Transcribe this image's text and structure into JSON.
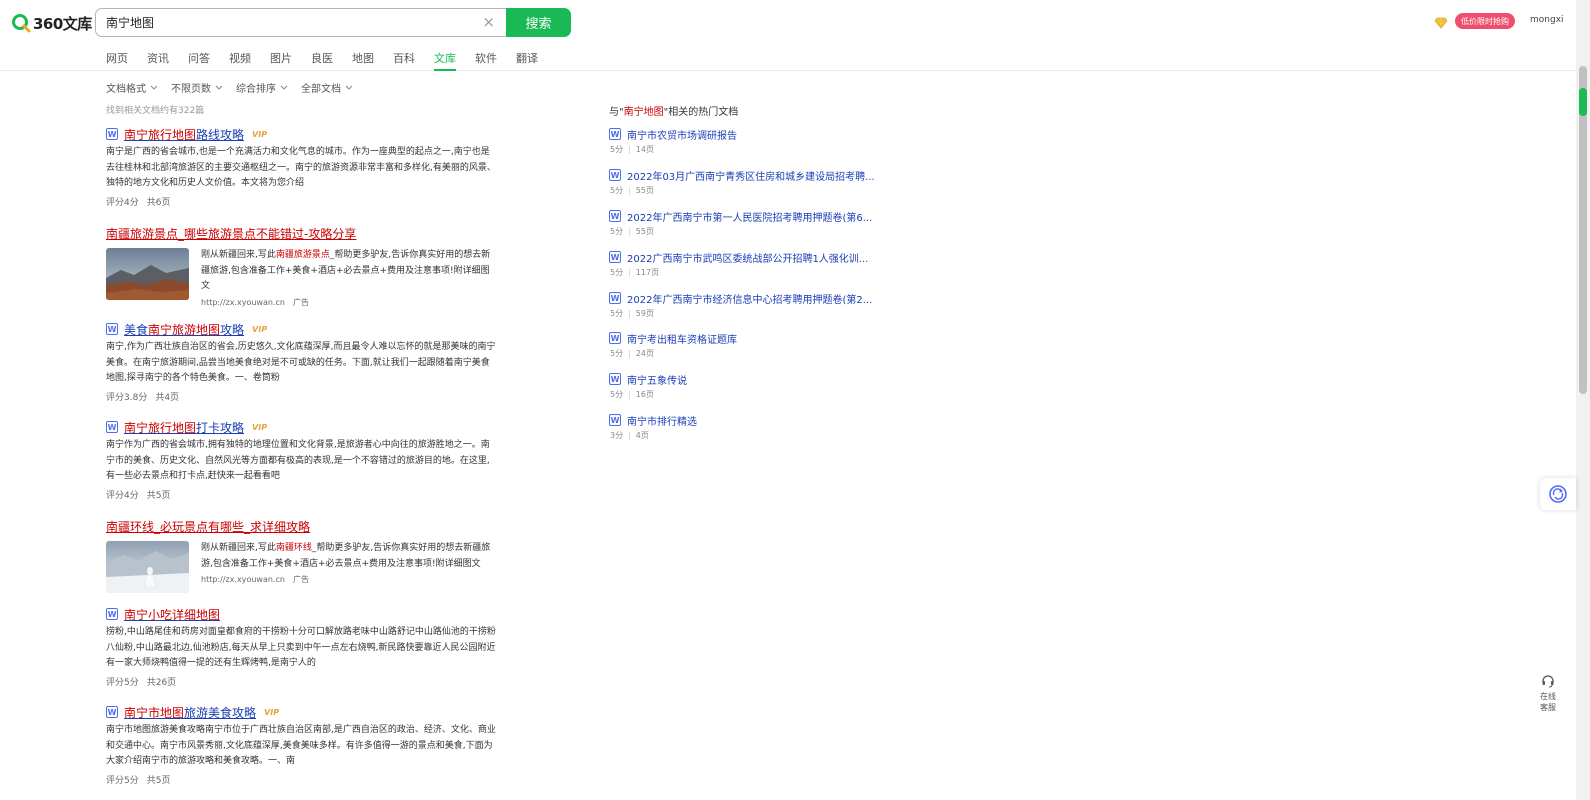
{
  "header": {
    "logo_text": "360文库",
    "search_value": "南宁地图",
    "search_button": "搜索",
    "clear_symbol": "×",
    "promo_label": "低价限时抢购",
    "username": "mongxi"
  },
  "nav": [
    "网页",
    "资讯",
    "问答",
    "视频",
    "图片",
    "良医",
    "地图",
    "百科",
    "文库",
    "软件",
    "翻译"
  ],
  "filters": [
    "文档格式",
    "不限页数",
    "综合排序",
    "全部文档"
  ],
  "result_count": "找到相关文档约有322篇",
  "results": [
    {
      "title_pre": "",
      "title_hl": "南宁旅行地图",
      "title_post": "路线攻略",
      "vip": "VIP",
      "snippet": "南宁是广西的省会城市,也是一个充满活力和文化气息的城市。作为一座典型的起点之一,南宁也是去往桂林和北部湾旅游区的主要交通枢纽之一。南宁的旅游资源非常丰富和多样化,有美丽的风景、独特的地方文化和历史人文价值。本文将为您介绍",
      "rating": "评分4分",
      "pages": "共6页"
    },
    {
      "title_pre": "美食",
      "title_hl": "南宁旅游地图",
      "title_post": "攻略",
      "vip": "VIP",
      "snippet": "南宁,作为广西壮族自治区的省会,历史悠久,文化底蕴深厚,而且最令人难以忘怀的就是那美味的南宁美食。在南宁旅游期间,品尝当地美食绝对是不可或缺的任务。下面,就让我们一起跟随着南宁美食地图,探寻南宁的各个特色美食。一、卷筒粉",
      "rating": "评分3.8分",
      "pages": "共4页"
    },
    {
      "title_pre": "",
      "title_hl": "南宁旅行地图",
      "title_post": "打卡攻略",
      "vip": "VIP",
      "snippet": "南宁作为广西的省会城市,拥有独特的地理位置和文化背景,是旅游者心中向往的旅游胜地之一。南宁市的美食、历史文化、自然风光等方面都有极高的表现,是一个不容错过的旅游目的地。在这里,有一些必去景点和打卡点,赶快来一起看看吧",
      "rating": "评分4分",
      "pages": "共5页"
    },
    {
      "title_pre": "",
      "title_hl": "南宁小吃详细地图",
      "title_post": "",
      "vip": "",
      "snippet": "捞粉,中山路尾佳和药房对面皇都食府的干捞粉十分可口解放路老味中山路舒记中山路仙池的干捞粉八仙粉,中山路最北边,仙池粉店,每天从早上只卖到中午一点左右烧鸭,新民路快要靠近人民公园附近有一家大师烧鸭值得一提的还有生辉烤鸭,是南宁人的",
      "rating": "评分5分",
      "pages": "共26页"
    },
    {
      "title_pre": "",
      "title_hl": "南宁市地图",
      "title_post": "旅游美食攻略",
      "vip": "VIP",
      "snippet": "南宁市地图旅游美食攻略南宁市位于广西壮族自治区南部,是广西自治区的政治、经济、文化、商业和交通中心。南宁市风景秀丽,文化底蕴深厚,美食美味多样。有许多值得一游的景点和美食,下面为大家介绍南宁市的旅游攻略和美食攻略。一、南",
      "rating": "评分5分",
      "pages": "共5页"
    }
  ],
  "ads": [
    {
      "title": "南疆旅游景点_哪些旅游景点不能错过-攻略分享",
      "snippet_pre": "刚从新疆回来,写此",
      "snippet_hl": "南疆旅游景点",
      "snippet_post": "_帮助更多驴友,告诉你真实好用的想去新疆旅游,包含准备工作+美食+酒店+必去景点+费用及注意事项!附详细图文",
      "url": "http://zx.xyouwan.cn",
      "ad_label": "广告"
    },
    {
      "title": "南疆环线_必玩景点有哪些_求详细攻略",
      "snippet_pre": "刚从新疆回来,写此",
      "snippet_hl": "南疆环线",
      "snippet_post": "_帮助更多驴友,告诉你真实好用的想去新疆旅游,包含准备工作+美食+酒店+必去景点+费用及注意事项!附详细图文",
      "url": "http://zx.xyouwan.cn",
      "ad_label": "广告"
    }
  ],
  "related": {
    "title_pre": "与\"",
    "title_hl": "南宁地图",
    "title_post": "\"相关的热门文档",
    "items": [
      {
        "title": "南宁市农贸市场调研报告",
        "score": "5分",
        "pages": "14页"
      },
      {
        "title": "2022年03月广西南宁青秀区住房和城乡建设局招考聘...",
        "score": "5分",
        "pages": "55页"
      },
      {
        "title": "2022年广西南宁市第一人民医院招考聘用押题卷(第6...",
        "score": "5分",
        "pages": "55页"
      },
      {
        "title": "2022广西南宁市武鸣区委统战部公开招聘1人强化训...",
        "score": "5分",
        "pages": "117页"
      },
      {
        "title": "2022年广西南宁市经济信息中心招考聘用押题卷(第2...",
        "score": "5分",
        "pages": "59页"
      },
      {
        "title": "南宁考出租车资格证题库",
        "score": "5分",
        "pages": "24页"
      },
      {
        "title": "南宁五象传说",
        "score": "5分",
        "pages": "16页"
      },
      {
        "title": "南宁市排行精选",
        "score": "3分",
        "pages": "4页"
      }
    ]
  },
  "customer_service": {
    "line1": "在线",
    "line2": "客服"
  },
  "colors": {
    "brand_green": "#19b955",
    "link_blue": "#1a3fb5",
    "highlight_red": "#c00"
  }
}
